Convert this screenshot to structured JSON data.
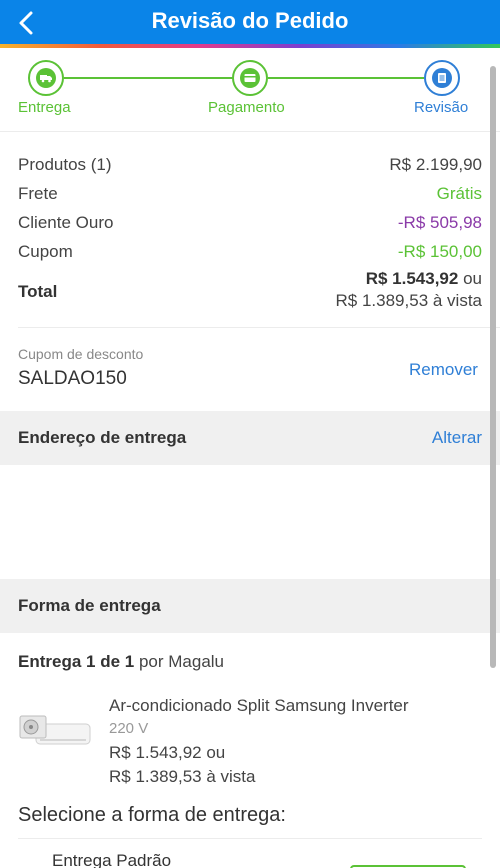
{
  "header": {
    "title": "Revisão do Pedido",
    "back_icon": "chevron-left-icon"
  },
  "stepper": {
    "steps": [
      {
        "label": "Entrega",
        "icon": "truck-icon",
        "status": "done"
      },
      {
        "label": "Pagamento",
        "icon": "credit-card-icon",
        "status": "done"
      },
      {
        "label": "Revisão",
        "icon": "document-icon",
        "status": "current"
      }
    ],
    "colors": {
      "done": "#5bc236",
      "current": "#2f7fd6"
    }
  },
  "summary": {
    "rows": [
      {
        "label": "Produtos (1)",
        "value": "R$ 2.199,90"
      },
      {
        "label": "Frete",
        "value": "Grátis"
      },
      {
        "label": "Cliente Ouro",
        "value": "-R$ 505,98"
      },
      {
        "label": "Cupom",
        "value": "-R$ 150,00"
      }
    ],
    "total_label": "Total",
    "total_value": "R$ 1.543,92",
    "total_or": "ou",
    "total_cash": "R$ 1.389,53 à vista"
  },
  "coupon": {
    "caption": "Cupom de desconto",
    "code": "SALDAO150",
    "remove_label": "Remover"
  },
  "address": {
    "title": "Endereço de entrega",
    "change_label": "Alterar"
  },
  "delivery": {
    "title": "Forma de entrega",
    "line_bold": "Entrega 1 de 1",
    "line_rest": "por Magalu",
    "product": {
      "name": "Ar-condicionado Split Samsung Inverter",
      "voltage": "220 V",
      "price": "R$ 1.543,92 ou",
      "cash_price": "R$ 1.389,53 à vista"
    },
    "select_title": "Selecione a forma de entrega:",
    "option_label": "Entrega Padrão"
  },
  "colors": {
    "brand_blue": "#0a84e8",
    "link": "#2f7fd6",
    "green": "#5bc236",
    "purple": "#8a3aa8"
  }
}
